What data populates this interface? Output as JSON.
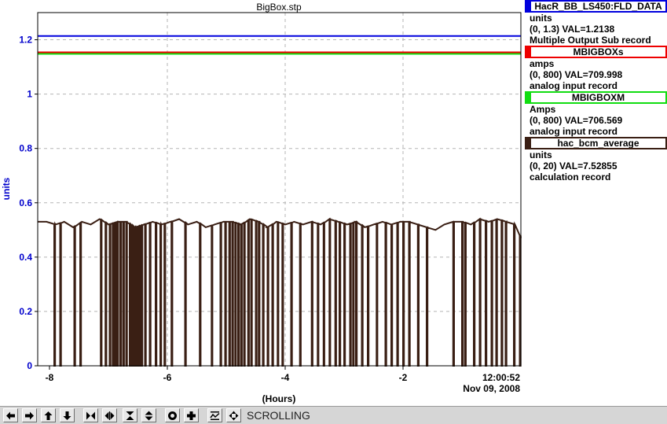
{
  "chart_data": {
    "type": "line",
    "title": "BigBox.stp",
    "xlabel": "(Hours)",
    "ylabel": "units",
    "xlim": [
      -8.2,
      0
    ],
    "ylim": [
      0,
      1.3
    ],
    "x_ticks": [
      -8,
      -6,
      -4,
      -2
    ],
    "x_tick_labels": [
      "-8",
      "-6",
      "-4",
      "-2"
    ],
    "y_ticks": [
      0,
      0.2,
      0.4,
      0.6,
      0.8,
      1,
      1.2
    ],
    "y_tick_labels": [
      "0",
      "0.2",
      "0.4",
      "0.6",
      "0.8",
      "1",
      "1.2"
    ],
    "time_label": "12:00:52",
    "date_label": "Nov 09, 2008",
    "grid": true,
    "legend_position": "right",
    "series": [
      {
        "name": "HacR_BB_LS450:FLD_DATA",
        "color": "#0000dd",
        "units": "units",
        "range_text": "(0, 1.3) VAL=1.2138",
        "record_type": "Multiple Output Sub record",
        "scale_max": 1.3,
        "values": [
          1.2138,
          1.2138
        ]
      },
      {
        "name": "MBIGBOXs",
        "color": "#ee0000",
        "units": "amps",
        "range_text": "(0, 800) VAL=709.998",
        "record_type": "analog input record",
        "scale_max": 800,
        "values": [
          709.998,
          709.998
        ]
      },
      {
        "name": "MBIGBOXM",
        "color": "#11dd11",
        "units": "Amps",
        "range_text": "(0, 800) VAL=706.569",
        "record_type": "analog input record",
        "scale_max": 800,
        "values": [
          706.569,
          706.569
        ]
      },
      {
        "name": "hac_bcm_average",
        "color": "#3a1f14",
        "units": "units",
        "range_text": "(0, 20) VAL=7.52855",
        "record_type": "calculation record",
        "scale_max": 20
      }
    ],
    "bcm_samples": {
      "x": [
        -8.2,
        -8.05,
        -7.9,
        -7.75,
        -7.6,
        -7.45,
        -7.3,
        -7.15,
        -7.0,
        -6.85,
        -6.7,
        -6.55,
        -6.4,
        -6.25,
        -6.1,
        -5.95,
        -5.8,
        -5.65,
        -5.5,
        -5.35,
        -5.2,
        -5.05,
        -4.9,
        -4.75,
        -4.6,
        -4.45,
        -4.3,
        -4.15,
        -4.0,
        -3.85,
        -3.7,
        -3.55,
        -3.4,
        -3.25,
        -3.1,
        -2.95,
        -2.8,
        -2.65,
        -2.5,
        -2.35,
        -2.2,
        -2.05,
        -1.9,
        -1.75,
        -1.6,
        -1.45,
        -1.3,
        -1.15,
        -1.0,
        -0.85,
        -0.7,
        -0.55,
        -0.4,
        -0.25,
        -0.1,
        0.0
      ],
      "y": [
        0.53,
        0.53,
        0.52,
        0.53,
        0.51,
        0.53,
        0.52,
        0.54,
        0.52,
        0.53,
        0.53,
        0.51,
        0.52,
        0.53,
        0.52,
        0.53,
        0.54,
        0.52,
        0.53,
        0.51,
        0.52,
        0.53,
        0.53,
        0.52,
        0.54,
        0.53,
        0.51,
        0.53,
        0.52,
        0.53,
        0.52,
        0.53,
        0.52,
        0.54,
        0.53,
        0.52,
        0.53,
        0.51,
        0.52,
        0.53,
        0.52,
        0.53,
        0.53,
        0.52,
        0.51,
        0.5,
        0.52,
        0.53,
        0.53,
        0.52,
        0.54,
        0.53,
        0.54,
        0.53,
        0.52,
        0.47
      ]
    },
    "bcm_dropouts_x": [
      -7.92,
      -7.82,
      -7.58,
      -7.48,
      -7.13,
      -7.05,
      -6.98,
      -6.93,
      -6.89,
      -6.85,
      -6.8,
      -6.75,
      -6.7,
      -6.64,
      -6.6,
      -6.56,
      -6.52,
      -6.48,
      -6.44,
      -6.38,
      -6.3,
      -6.2,
      -6.12,
      -6.05,
      -5.93,
      -5.7,
      -5.45,
      -5.25,
      -5.1,
      -5.02,
      -4.95,
      -4.9,
      -4.85,
      -4.8,
      -4.75,
      -4.7,
      -4.63,
      -4.58,
      -4.5,
      -4.45,
      -4.38,
      -4.3,
      -4.22,
      -4.13,
      -4.05,
      -3.9,
      -3.75,
      -3.55,
      -3.45,
      -3.35,
      -3.25,
      -3.15,
      -3.08,
      -3.0,
      -2.9,
      -2.85,
      -2.8,
      -2.7,
      -2.6,
      -2.45,
      -2.3,
      -2.2,
      -2.1,
      -2.0,
      -1.9,
      -1.75,
      -1.6,
      -1.15,
      -1.0,
      -0.95,
      -0.8,
      -0.7,
      -0.6,
      -0.5,
      -0.42,
      -0.33,
      -0.26,
      -0.12,
      -0.02
    ]
  },
  "toolbar": {
    "buttons": [
      "arrow-left-icon",
      "arrow-right-icon",
      "arrow-up-icon",
      "arrow-down-icon",
      "zoom-in-horizontal-icon",
      "zoom-out-horizontal-icon",
      "zoom-in-vertical-icon",
      "zoom-out-vertical-icon",
      "auto-scale-icon",
      "add-icon",
      "scroll-mode-icon",
      "pan-icon"
    ],
    "status": "SCROLLING"
  }
}
